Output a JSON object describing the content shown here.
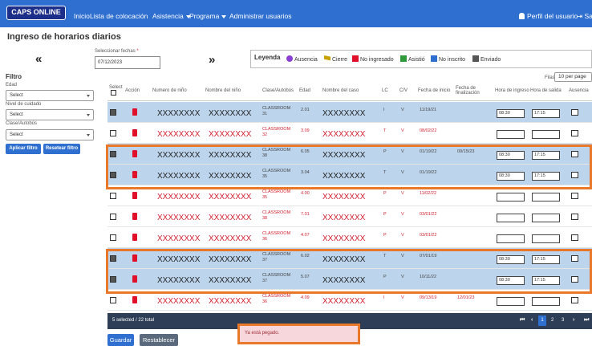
{
  "nav": {
    "logo": "CAPS ONLINE",
    "inicio": "Inicio",
    "lista": "Lista de colocación",
    "asistencia": "Asistencia",
    "programa": "Programa",
    "administrar": "Administrar usuarios",
    "perfil": "Perfil del usuario",
    "salir": "Sa"
  },
  "page_title": "Ingreso de horarios diarios",
  "date_select": {
    "label": "Seleccionar fechas",
    "required_mark": "*",
    "value": "07/12/2023"
  },
  "legend": {
    "title": "Leyenda",
    "items": [
      {
        "label": "Ausencia",
        "color": "#8a3fd0"
      },
      {
        "label": "Cierre",
        "color": "#c8a000"
      },
      {
        "label": "No ingresado",
        "color": "#e0102a"
      },
      {
        "label": "Asistió",
        "color": "#2e9a3a"
      },
      {
        "label": "No inscrito",
        "color": "#2f6fd0"
      },
      {
        "label": "Enviado",
        "color": "#555555"
      }
    ]
  },
  "filter": {
    "title": "Filtro",
    "edad_label": "Edad",
    "nivel_label": "Nivel de cuidado",
    "clase_label": "Clase/Autobús",
    "select_text": "Select",
    "apply": "Aplicar filtro",
    "reset": "Resetear filtro"
  },
  "rows_per_page": {
    "label": "Filas",
    "value": "10 per page"
  },
  "table": {
    "headers": {
      "select": "Select",
      "accion": "Acción",
      "numero": "Numero de niño",
      "nombre": "Nombre del niño",
      "clase": "Clase/Autobús",
      "edad": "Edad",
      "caso": "Nombre del caso",
      "lc": "LC",
      "cv": "C/V",
      "inicio": "Fecha de inicio",
      "fin": "Fecha de finalización",
      "ingreso": "Hora de ingreso",
      "salida": "Hora de salida",
      "ausencia": "Ausencia"
    },
    "rows": [
      {
        "checked": true,
        "sel": true,
        "num": "XXXXXXXX",
        "name": "XXXXXXXX",
        "class": "CLASSROOM",
        "class_no": "31",
        "age": "2.01",
        "case": "XXXXXXXX",
        "lc": "I",
        "cv": "V",
        "start": "11/19/21",
        "end": "",
        "in": "08:30",
        "out": "17:15"
      },
      {
        "checked": false,
        "sel": false,
        "num": "XXXXXXXX",
        "name": "XXXXXXXX",
        "class": "CLASSROOM",
        "class_no": "32",
        "age": "3.09",
        "case": "XXXXXXXX",
        "lc": "T",
        "cv": "V",
        "start": "08/02/22",
        "end": "",
        "in": "",
        "out": ""
      },
      {
        "checked": true,
        "sel": true,
        "num": "XXXXXXXX",
        "name": "XXXXXXXX",
        "class": "CLASSROOM",
        "class_no": "38",
        "age": "6.05",
        "case": "XXXXXXXX",
        "lc": "P",
        "cv": "V",
        "start": "01/19/22",
        "end": "09/15/23",
        "in": "08:30",
        "out": "17:15"
      },
      {
        "checked": true,
        "sel": true,
        "num": "XXXXXXXX",
        "name": "XXXXXXXX",
        "class": "CLASSROOM",
        "class_no": "35",
        "age": "3.04",
        "case": "XXXXXXXX",
        "lc": "T",
        "cv": "V",
        "start": "01/19/22",
        "end": "",
        "in": "08:30",
        "out": "17:15"
      },
      {
        "checked": false,
        "sel": false,
        "num": "XXXXXXXX",
        "name": "XXXXXXXX",
        "class": "CLASSROOM",
        "class_no": "35",
        "age": "4.00",
        "case": "XXXXXXXX",
        "lc": "P",
        "cv": "V",
        "start": "11/02/22",
        "end": "",
        "in": "",
        "out": ""
      },
      {
        "checked": false,
        "sel": false,
        "num": "XXXXXXXX",
        "name": "XXXXXXXX",
        "class": "CLASSROOM",
        "class_no": "38",
        "age": "7.01",
        "case": "XXXXXXXX",
        "lc": "P",
        "cv": "V",
        "start": "03/01/22",
        "end": "",
        "in": "",
        "out": ""
      },
      {
        "checked": false,
        "sel": false,
        "num": "XXXXXXXX",
        "name": "XXXXXXXX",
        "class": "CLASSROOM",
        "class_no": "36",
        "age": "4.07",
        "case": "XXXXXXXX",
        "lc": "P",
        "cv": "V",
        "start": "03/01/22",
        "end": "",
        "in": "",
        "out": ""
      },
      {
        "checked": true,
        "sel": true,
        "num": "XXXXXXXX",
        "name": "XXXXXXXX",
        "class": "CLASSROOM",
        "class_no": "37",
        "age": "6.02",
        "case": "XXXXXXXX",
        "lc": "T",
        "cv": "V",
        "start": "07/01/19",
        "end": "",
        "in": "08:30",
        "out": "17:15"
      },
      {
        "checked": true,
        "sel": true,
        "num": "XXXXXXXX",
        "name": "XXXXXXXX",
        "class": "CLASSROOM",
        "class_no": "37",
        "age": "5.07",
        "case": "XXXXXXXX",
        "lc": "P",
        "cv": "V",
        "start": "10/11/22",
        "end": "",
        "in": "08:30",
        "out": "17:15"
      },
      {
        "checked": false,
        "sel": false,
        "num": "XXXXXXXX",
        "name": "XXXXXXXX",
        "class": "CLASSROOM",
        "class_no": "36",
        "age": "4.09",
        "case": "XXXXXXXX",
        "lc": "I",
        "cv": "V",
        "start": "09/13/19",
        "end": "12/01/23",
        "in": "",
        "out": ""
      }
    ]
  },
  "footer": {
    "selected": "5 selected / 22 total",
    "pages": [
      "1",
      "2",
      "3"
    ]
  },
  "toast": "Ya está pegado.",
  "buttons": {
    "guardar": "Guardar",
    "restablecer": "Restablecer"
  }
}
